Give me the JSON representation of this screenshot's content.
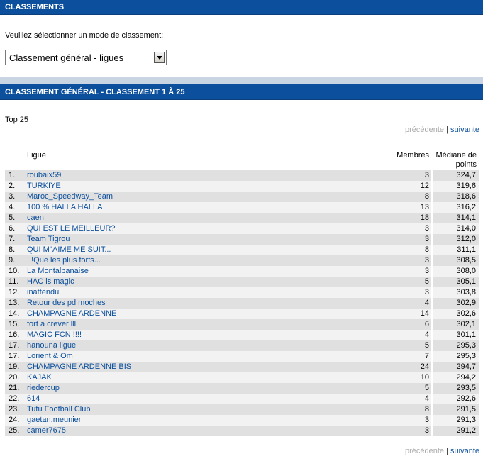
{
  "header": {
    "title": "CLASSEMENTS"
  },
  "selector": {
    "prompt": "Veuillez sélectionner un mode de classement:",
    "selected": "Classement général - ligues"
  },
  "section": {
    "title": "CLASSEMENT GÉNÉRAL - CLASSEMENT 1 À 25"
  },
  "top_label": "Top 25",
  "pager": {
    "prev": "précédente",
    "sep": "|",
    "next": "suivante"
  },
  "table": {
    "col_ligue": "Ligue",
    "col_membres": "Membres",
    "col_mediane_1": "Médiane de",
    "col_mediane_2": "points",
    "rows": [
      {
        "rank": "1.",
        "name": "roubaix59",
        "members": "3",
        "points": "324,7"
      },
      {
        "rank": "2.",
        "name": "TURKIYE",
        "members": "12",
        "points": "319,6"
      },
      {
        "rank": "3.",
        "name": "Maroc_Speedway_Team",
        "members": "8",
        "points": "318,6"
      },
      {
        "rank": "4.",
        "name": "100 % HALLA HALLA",
        "members": "13",
        "points": "316,2"
      },
      {
        "rank": "5.",
        "name": "caen",
        "members": "18",
        "points": "314,1"
      },
      {
        "rank": "6.",
        "name": "QUI EST LE MEILLEUR?",
        "members": "3",
        "points": "314,0"
      },
      {
        "rank": "7.",
        "name": "Team Tigrou",
        "members": "3",
        "points": "312,0"
      },
      {
        "rank": "8.",
        "name": "QUI M''AIME ME SUIT...",
        "members": "8",
        "points": "311,1"
      },
      {
        "rank": "9.",
        "name": "!!!Que les plus forts...",
        "members": "3",
        "points": "308,5"
      },
      {
        "rank": "10.",
        "name": "La Montalbanaise",
        "members": "3",
        "points": "308,0"
      },
      {
        "rank": "11.",
        "name": "HAC is magic",
        "members": "5",
        "points": "305,1"
      },
      {
        "rank": "12.",
        "name": "inattendu",
        "members": "3",
        "points": "303,8"
      },
      {
        "rank": "13.",
        "name": "Retour des pd moches",
        "members": "4",
        "points": "302,9"
      },
      {
        "rank": "14.",
        "name": "CHAMPAGNE ARDENNE",
        "members": "14",
        "points": "302,6"
      },
      {
        "rank": "15.",
        "name": "fort à crever lll",
        "members": "6",
        "points": "302,1"
      },
      {
        "rank": "16.",
        "name": "MAGIC FCN !!!!",
        "members": "4",
        "points": "301,1"
      },
      {
        "rank": "17.",
        "name": "hanouna ligue",
        "members": "5",
        "points": "295,3"
      },
      {
        "rank": "17.",
        "name": "Lorient & Om",
        "members": "7",
        "points": "295,3"
      },
      {
        "rank": "19.",
        "name": "CHAMPAGNE ARDENNE BIS",
        "members": "24",
        "points": "294,7"
      },
      {
        "rank": "20.",
        "name": "KAJAK",
        "members": "10",
        "points": "294,2"
      },
      {
        "rank": "21.",
        "name": "riedercup",
        "members": "5",
        "points": "293,5"
      },
      {
        "rank": "22.",
        "name": "614",
        "members": "4",
        "points": "292,6"
      },
      {
        "rank": "23.",
        "name": "Tutu Football Club",
        "members": "8",
        "points": "291,5"
      },
      {
        "rank": "24.",
        "name": "gaetan.meunier",
        "members": "3",
        "points": "291,3"
      },
      {
        "rank": "25.",
        "name": "camer7675",
        "members": "3",
        "points": "291,2"
      }
    ]
  }
}
